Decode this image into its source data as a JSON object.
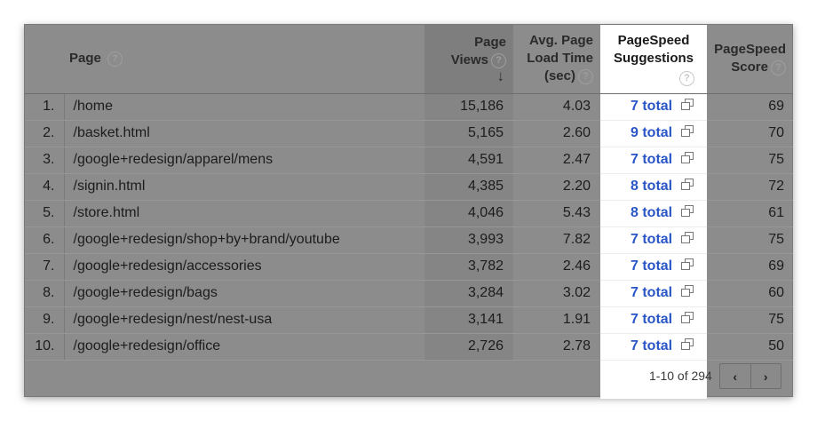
{
  "columns": {
    "page": "Page",
    "page_views": [
      "Page",
      "Views"
    ],
    "load_time": [
      "Avg. Page",
      "Load Time",
      "(sec)"
    ],
    "suggestions": [
      "PageSpeed",
      "Suggestions"
    ],
    "score": [
      "PageSpeed",
      "Score"
    ],
    "help_glyph": "?",
    "sort_arrow": "↓"
  },
  "rows": [
    {
      "idx": "1.",
      "page": "/home",
      "views": "15,186",
      "load": "4.03",
      "sugg": "7 total",
      "score": "69"
    },
    {
      "idx": "2.",
      "page": "/basket.html",
      "views": "5,165",
      "load": "2.60",
      "sugg": "9 total",
      "score": "70"
    },
    {
      "idx": "3.",
      "page": "/google+redesign/apparel/mens",
      "views": "4,591",
      "load": "2.47",
      "sugg": "7 total",
      "score": "75"
    },
    {
      "idx": "4.",
      "page": "/signin.html",
      "views": "4,385",
      "load": "2.20",
      "sugg": "8 total",
      "score": "72"
    },
    {
      "idx": "5.",
      "page": "/store.html",
      "views": "4,046",
      "load": "5.43",
      "sugg": "8 total",
      "score": "61"
    },
    {
      "idx": "6.",
      "page": "/google+redesign/shop+by+brand/youtube",
      "views": "3,993",
      "load": "7.82",
      "sugg": "7 total",
      "score": "75"
    },
    {
      "idx": "7.",
      "page": "/google+redesign/accessories",
      "views": "3,782",
      "load": "2.46",
      "sugg": "7 total",
      "score": "69"
    },
    {
      "idx": "8.",
      "page": "/google+redesign/bags",
      "views": "3,284",
      "load": "3.02",
      "sugg": "7 total",
      "score": "60"
    },
    {
      "idx": "9.",
      "page": "/google+redesign/nest/nest-usa",
      "views": "3,141",
      "load": "1.91",
      "sugg": "7 total",
      "score": "75"
    },
    {
      "idx": "10.",
      "page": "/google+redesign/office",
      "views": "2,726",
      "load": "2.78",
      "sugg": "7 total",
      "score": "50"
    }
  ],
  "pager": {
    "label": "1-10 of 294",
    "prev": "‹",
    "next": "›"
  },
  "colors": {
    "link": "#2a56c6",
    "overlay": "#8c8c8c",
    "highlight": "#ffffff"
  }
}
